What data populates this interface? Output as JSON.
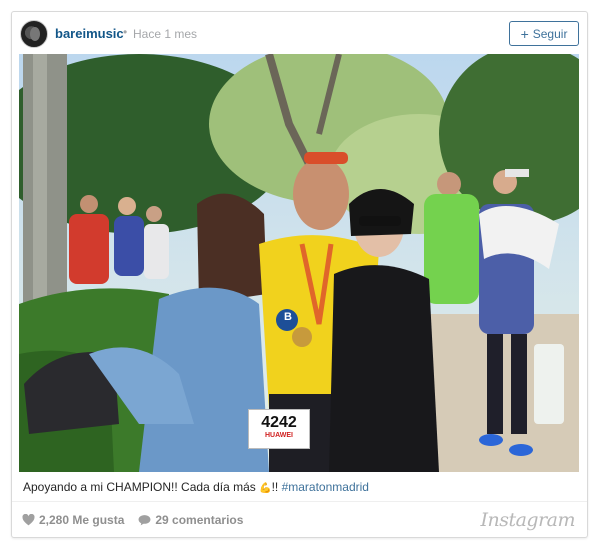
{
  "post": {
    "username": "bareimusic",
    "separator": "•",
    "timestamp": "Hace 1 mes",
    "follow_label": "Seguir",
    "follow_icon": "plus-icon"
  },
  "photo": {
    "bib_number": "4242",
    "bib_sponsor": "HUAWEI",
    "shirt_text": "B"
  },
  "caption": {
    "text": "Apoyando a mi CHAMPION!! Cada día más ",
    "emoji": "flexed-biceps",
    "after_emoji": "!! ",
    "hashtag": "#maratonmadrid"
  },
  "stats": {
    "likes": "2,280 Me gusta",
    "comments": "29 comentarios"
  },
  "brand": {
    "logo_text": "Instagram"
  },
  "colors": {
    "username": "#125688",
    "follow": "#3f729b",
    "muted": "#a5a7aa"
  }
}
